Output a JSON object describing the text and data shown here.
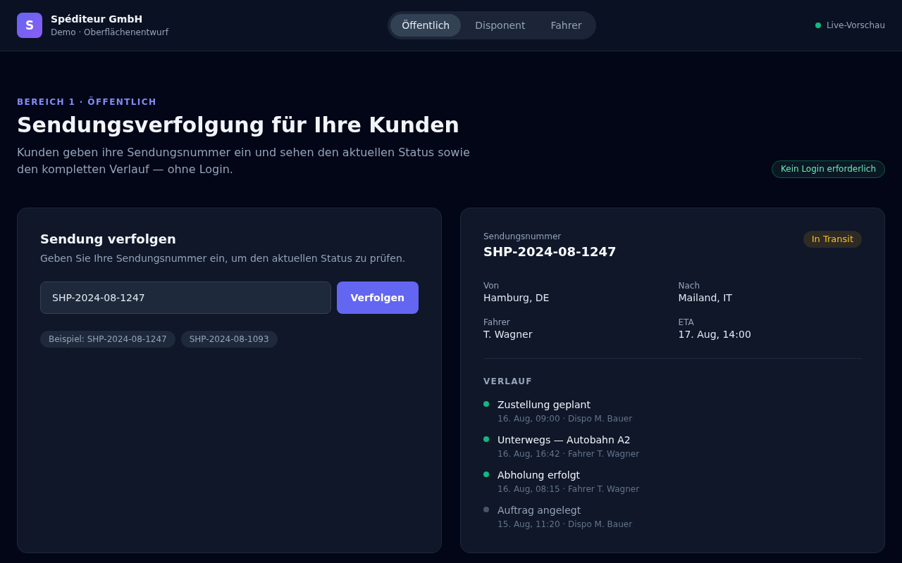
{
  "header": {
    "logo": "S",
    "company": "Spéditeur GmbH",
    "subtitle": "Demo · Oberflächenentwurf",
    "tabs": [
      {
        "label": "Öffentlich",
        "selected": true
      },
      {
        "label": "Disponent",
        "selected": false
      },
      {
        "label": "Fahrer",
        "selected": false
      }
    ],
    "live_indicator": "Live-Vorschau"
  },
  "intro": {
    "eyebrow": "BEREICH 1 · ÖFFENTLICH",
    "title": "Sendungsverfolgung für Ihre Kunden",
    "description": "Kunden geben ihre Sendungsnummer ein und sehen den aktuellen Status sowie den kompletten Verlauf — ohne Login.",
    "badge": "Kein Login erforderlich"
  },
  "tracking_form": {
    "title": "Sendung verfolgen",
    "description": "Geben Sie Ihre Sendungsnummer ein, um den aktuellen Status zu prüfen.",
    "input": {
      "value": "SHP-2024-08-1247"
    },
    "button": "Verfolgen",
    "examples": [
      "Beispiel: SHP-2024-08-1247",
      "SHP-2024-08-1093"
    ]
  },
  "shipment": {
    "number_label": "Sendungsnummer",
    "number": "SHP-2024-08-1247",
    "status": {
      "label": "In Transit",
      "kind": "transit"
    },
    "details": [
      {
        "label": "Von",
        "value": "Hamburg, DE"
      },
      {
        "label": "Nach",
        "value": "Mailand, IT"
      },
      {
        "label": "Fahrer",
        "value": "T. Wagner"
      },
      {
        "label": "ETA",
        "value": "17. Aug, 14:00"
      }
    ],
    "history_title": "VERLAUF",
    "history": [
      {
        "title": "Zustellung geplant",
        "meta": "16. Aug, 09:00 · Dispo M. Bauer",
        "done": true
      },
      {
        "title": "Unterwegs — Autobahn A2",
        "meta": "16. Aug, 16:42 · Fahrer T. Wagner",
        "done": true
      },
      {
        "title": "Abholung erfolgt",
        "meta": "16. Aug, 08:15 · Fahrer T. Wagner",
        "done": true
      },
      {
        "title": "Auftrag angelegt",
        "meta": "15. Aug, 11:20 · Dispo M. Bauer",
        "done": false
      }
    ]
  }
}
